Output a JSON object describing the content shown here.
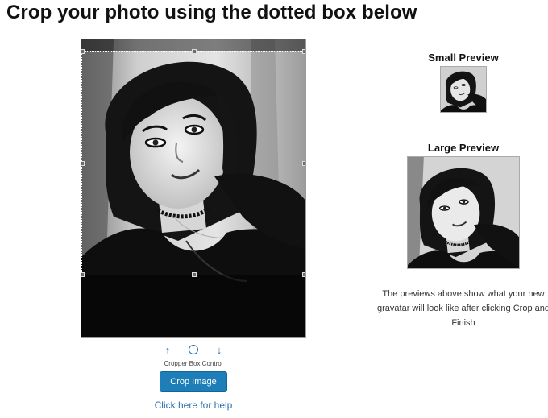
{
  "page": {
    "title": "Crop your photo using the dotted box below"
  },
  "cropper": {
    "photo_icon": "portrait-photo-grayscale",
    "controls": {
      "up_label": "↑",
      "center_label": "",
      "down_label": "↓"
    },
    "control_label": "Cropper Box Control",
    "crop_button_label": "Crop Image",
    "help_link": "Click here for help"
  },
  "previews": {
    "small_title": "Small Preview",
    "large_title": "Large Preview",
    "note": "The previews above show what your new gravatar will look like after clicking Crop and Finish"
  },
  "colors": {
    "accent": "#1e7fb8",
    "link": "#2a6fb0"
  }
}
